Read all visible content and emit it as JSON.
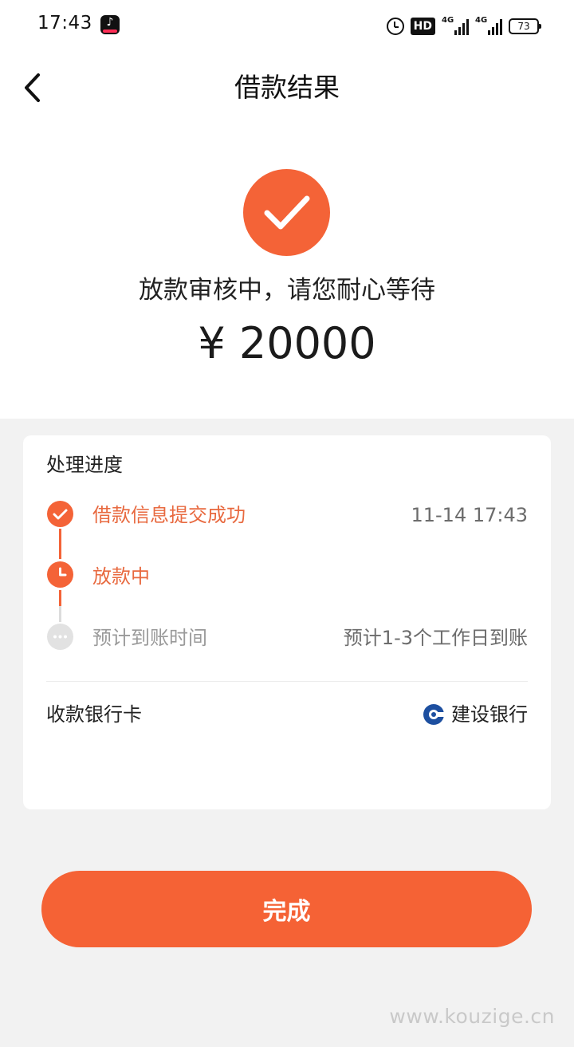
{
  "status_bar": {
    "time": "17:43",
    "app_icon": "tiktok-icon",
    "alarm_icon": "alarm-icon",
    "hd_label": "HD",
    "network_1": "4G",
    "network_2": "4G",
    "battery": "73"
  },
  "header": {
    "back_icon": "chevron-left-icon",
    "title": "借款结果"
  },
  "hero": {
    "icon": "check-icon",
    "status_message": "放款审核中，请您耐心等待",
    "amount": "¥ 20000"
  },
  "progress": {
    "title": "处理进度",
    "steps": [
      {
        "icon": "check-icon",
        "label": "借款信息提交成功",
        "right": "11-14 17:43"
      },
      {
        "icon": "clock-icon",
        "label": "放款中",
        "right": ""
      },
      {
        "icon": "ellipsis-icon",
        "label": "预计到账时间",
        "right": "预计1-3个工作日到账"
      }
    ]
  },
  "bank": {
    "label": "收款银行卡",
    "logo_icon": "ccb-bank-logo-icon",
    "name": "建设银行"
  },
  "actions": {
    "done_label": "完成"
  },
  "watermark": "www.kouzige.cn",
  "colors": {
    "accent": "#f46337",
    "step_text": "#e8693f",
    "pending": "#e2e2e2",
    "background": "#f2f2f2"
  }
}
